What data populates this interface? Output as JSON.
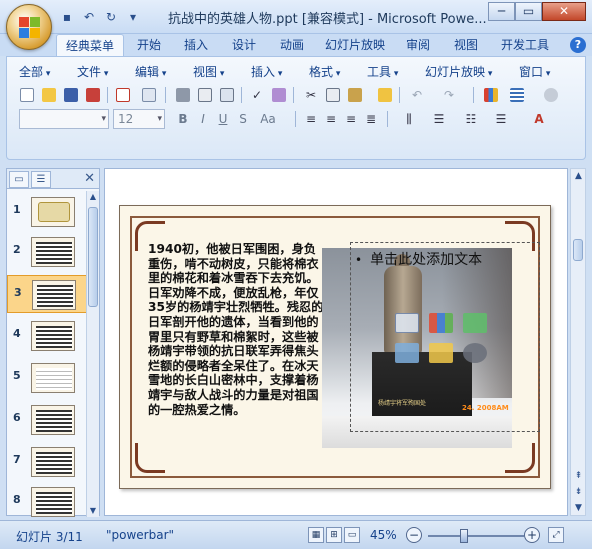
{
  "window": {
    "title": "抗战中的英雄人物.ppt [兼容模式] - Microsoft Powe...",
    "min": "─",
    "max": "▭",
    "close": "✕"
  },
  "ribbon_tabs": [
    {
      "label": "经典菜单",
      "active": true
    },
    {
      "label": "开始"
    },
    {
      "label": "插入"
    },
    {
      "label": "设计"
    },
    {
      "label": "动画"
    },
    {
      "label": "幻灯片放映"
    },
    {
      "label": "审阅"
    },
    {
      "label": "视图"
    },
    {
      "label": "开发工具"
    }
  ],
  "help": "?",
  "menus": [
    "全部",
    "文件",
    "编辑",
    "视图",
    "插入",
    "格式",
    "工具",
    "幻灯片放映",
    "窗口"
  ],
  "font_combo": {
    "value": ""
  },
  "size_combo": {
    "value": "12"
  },
  "format_buttons": {
    "bold": "B",
    "italic": "I",
    "underline": "U",
    "strike": "S",
    "case": "Aa"
  },
  "thumbnails": [
    {
      "num": "1"
    },
    {
      "num": "2"
    },
    {
      "num": "3",
      "selected": true
    },
    {
      "num": "4"
    },
    {
      "num": "5"
    },
    {
      "num": "6"
    },
    {
      "num": "7"
    },
    {
      "num": "8"
    }
  ],
  "slide": {
    "body": "1940初，他被日军围困，身负重伤，啃不动树皮，只能将棉衣里的棉花和着冰雪吞下去充饥。日军劝降不成，便放乱枪，年仅35岁的杨靖宇壮烈牺牲。残忍的日军剖开他的遗体，当看到他的胃里只有野草和棉絮时，这些被杨靖宇带领的抗日联军弄得焦头烂额的侵略者全呆住了。在冰天雪地的长白山密林中，支撑着杨靖宇与敌人战斗的力量是对祖国的一腔热爱之情。",
    "placeholder": "单击此处添加文本",
    "photo_stamp": "24. 2008AM",
    "photo_caption": "杨靖宇将军殉国处"
  },
  "status": {
    "slide_info": "幻灯片 3/11",
    "theme": "\"powerbar\"",
    "zoom": "45%",
    "zoom_minus": "−",
    "zoom_plus": "+",
    "zoom_fraction": 0.38
  },
  "colors": {
    "accent": "#15428b",
    "selected_thumb": "#fbd58a",
    "slide_bg": "#fbf6e8",
    "frame": "#8b5a3c"
  }
}
